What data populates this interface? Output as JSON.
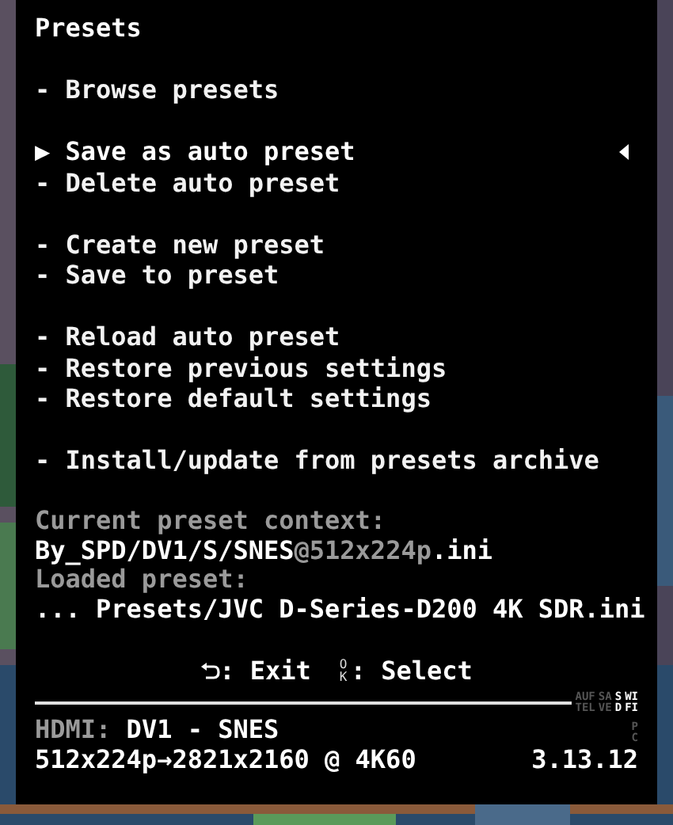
{
  "title": "Presets",
  "menu_groups": [
    [
      {
        "bullet": "-",
        "label": "Browse presets",
        "selected": false
      }
    ],
    [
      {
        "bullet": "▶",
        "label": "Save as auto preset",
        "selected": true
      },
      {
        "bullet": "-",
        "label": "Delete auto preset",
        "selected": false
      }
    ],
    [
      {
        "bullet": "-",
        "label": "Create new preset",
        "selected": false
      },
      {
        "bullet": "-",
        "label": "Save to preset",
        "selected": false
      }
    ],
    [
      {
        "bullet": "-",
        "label": "Reload auto preset",
        "selected": false
      },
      {
        "bullet": "-",
        "label": "Restore previous settings",
        "selected": false
      },
      {
        "bullet": "-",
        "label": "Restore default settings",
        "selected": false
      }
    ],
    [
      {
        "bullet": "-",
        "label": "Install/update from presets archive",
        "selected": false
      }
    ]
  ],
  "info": [
    {
      "parts": [
        {
          "text": "Current preset context:",
          "dim": true
        }
      ]
    },
    {
      "parts": [
        {
          "text": "By_SPD/DV1/S/SNES",
          "dim": false
        },
        {
          "text": "@512x224p",
          "dim": true
        },
        {
          "text": ".ini",
          "dim": false
        }
      ]
    },
    {
      "parts": [
        {
          "text": "Loaded preset:",
          "dim": true
        }
      ]
    },
    {
      "parts": [
        {
          "text": "... Presets/JVC D-Series-D200 4K SDR.ini",
          "dim": false
        }
      ]
    }
  ],
  "hints": [
    {
      "kind": "back",
      "label": ": Exit"
    },
    {
      "kind": "key",
      "key": "OK",
      "label": ": Select"
    }
  ],
  "indicators": [
    {
      "lines": [
        "AUF",
        "TEL"
      ],
      "on": false
    },
    {
      "lines": [
        "SA",
        "VE"
      ],
      "on": false
    },
    {
      "lines": [
        "S",
        "D"
      ],
      "on": true
    },
    {
      "lines": [
        "WI",
        "FI"
      ],
      "on": true
    }
  ],
  "pc_indicator": {
    "lines": [
      "P",
      "C"
    ],
    "on": false
  },
  "status": {
    "input_parts": [
      {
        "text": "HDMI:",
        "dim": true
      },
      {
        "text": " DV1 - SNES",
        "dim": false
      }
    ],
    "resolution": "512x224p→2821x2160 @ 4K60",
    "version": "3.13.12"
  }
}
